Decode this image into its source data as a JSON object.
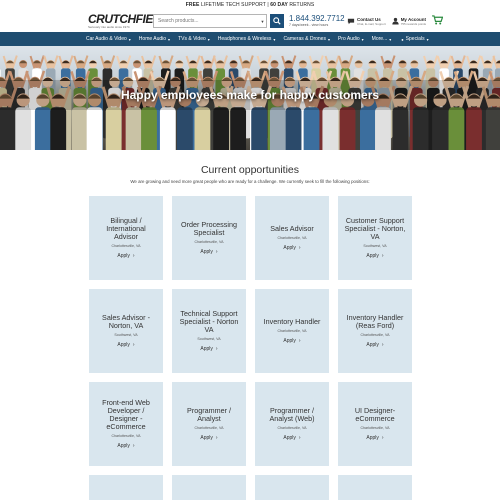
{
  "topbar": {
    "part1": "FREE",
    "part2": " LIFETIME TECH SUPPORT  |  ",
    "part3": "60 DAY",
    "part4": " RETURNS"
  },
  "header": {
    "brand": "CRUTCHFIELD",
    "tagline": "Seriously into audio since 1974",
    "search_placeholder": "Search products...",
    "phone": "1.844.392.7712",
    "phone_hours": "7 days/week - view hours",
    "contact_title": "Contact Us",
    "contact_sub": "Chat, E-mail, Support",
    "account_title": "My Account",
    "account_sub": "755 rewards points"
  },
  "nav": [
    {
      "label": "Car Audio & Video"
    },
    {
      "label": "Home Audio"
    },
    {
      "label": "TVs & Video"
    },
    {
      "label": "Headphones & Wireless"
    },
    {
      "label": "Cameras & Drones"
    },
    {
      "label": "Pro Audio"
    },
    {
      "label": "More..."
    },
    {
      "label": "Specials"
    }
  ],
  "hero": {
    "title": "Happy employees make for happy customers"
  },
  "section": {
    "title": "Current opportunities",
    "subtitle": "We are growing and need more great people who are ready for a challenge. We currently seek to fill the following positions:"
  },
  "apply_label": "Apply",
  "jobs": [
    {
      "title": "Bilingual / International Advisor",
      "location": "Charlottesville, VA"
    },
    {
      "title": "Order Processing Specialist",
      "location": "Charlottesville, VA"
    },
    {
      "title": "Sales Advisor",
      "location": "Charlottesville, VA"
    },
    {
      "title": "Customer Support Specialist - Norton, VA",
      "location": "Southwest, VA"
    },
    {
      "title": "Sales Advisor - Norton, VA",
      "location": "Southwest, VA"
    },
    {
      "title": "Technical Support Specialist - Norton VA",
      "location": "Southwest, VA"
    },
    {
      "title": "Inventory Handler",
      "location": "Charlottesville, VA"
    },
    {
      "title": "Inventory Handler (Reas Ford)",
      "location": "Charlottesville, VA"
    },
    {
      "title": "Front-end Web Developer / Designer - eCommerce",
      "location": "Charlottesville, VA"
    },
    {
      "title": "Programmer / Analyst",
      "location": "Charlottesville, VA"
    },
    {
      "title": "Programmer / Analyst (Web)",
      "location": "Charlottesville, VA"
    },
    {
      "title": "UI Designer-eCommerce",
      "location": "Charlottesville, VA"
    }
  ]
}
